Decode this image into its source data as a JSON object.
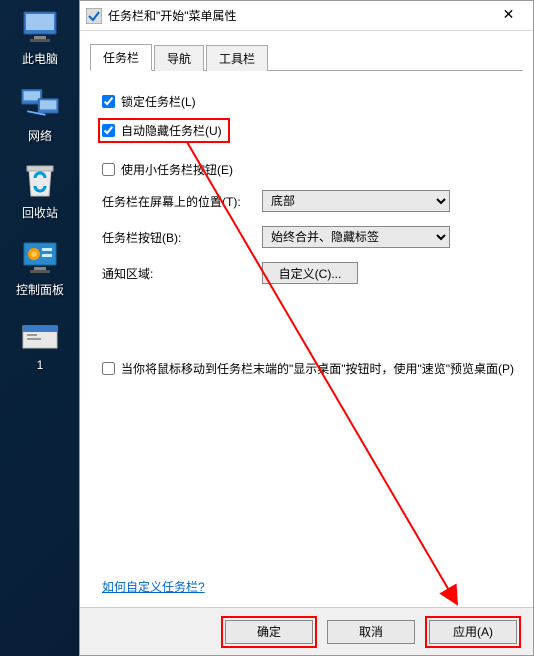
{
  "desktop": {
    "items": [
      {
        "label": "此电脑",
        "icon": "computer-icon"
      },
      {
        "label": "网络",
        "icon": "network-icon"
      },
      {
        "label": "回收站",
        "icon": "recycle-bin-icon"
      },
      {
        "label": "控制面板",
        "icon": "control-panel-icon"
      },
      {
        "label": "1",
        "icon": "folder-icon"
      }
    ]
  },
  "dialog": {
    "title": "任务栏和\"开始\"菜单属性",
    "tabs": [
      {
        "label": "任务栏",
        "active": true
      },
      {
        "label": "导航",
        "active": false
      },
      {
        "label": "工具栏",
        "active": false
      }
    ],
    "checkboxes": {
      "lock": {
        "label": "锁定任务栏(L)",
        "checked": true
      },
      "autohide": {
        "label": "自动隐藏任务栏(U)",
        "checked": true
      },
      "smallbuttons": {
        "label": "使用小任务栏按钮(E)",
        "checked": false
      }
    },
    "rows": {
      "position": {
        "label": "任务栏在屏幕上的位置(T):",
        "value": "底部"
      },
      "buttons": {
        "label": "任务栏按钮(B):",
        "value": "始终合并、隐藏标签"
      },
      "notify": {
        "label": "通知区域:",
        "button": "自定义(C)..."
      }
    },
    "peek": {
      "label": "当你将鼠标移动到任务栏末端的\"显示桌面\"按钮时，使用\"速览\"预览桌面(P)",
      "checked": false
    },
    "helplink": "如何自定义任务栏?",
    "buttons": {
      "ok": "确定",
      "cancel": "取消",
      "apply": "应用(A)"
    }
  }
}
